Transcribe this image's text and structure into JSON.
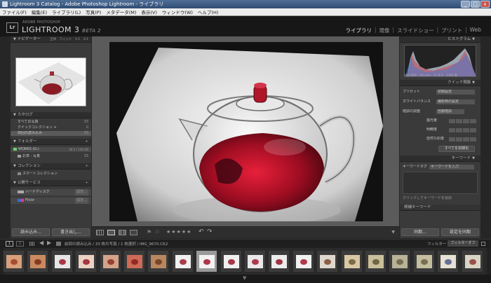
{
  "window": {
    "title": "Lightroom 3 Catalog - Adobe Photoshop Lightroom - ライブラリ",
    "min": "_",
    "max": "□",
    "close": "x"
  },
  "menu": [
    "ファイル(F)",
    "編集(E)",
    "ライブラリ(L)",
    "写真(P)",
    "メタデータ(M)",
    "表示(V)",
    "ウィンドウ(W)",
    "ヘルプ(H)"
  ],
  "brand": {
    "badge": "Lr",
    "line1": "ADOBE PHOTOSHOP",
    "line2": "LIGHTROOM 3",
    "beta": "BETA 2"
  },
  "modules": [
    {
      "label": "ライブラリ",
      "active": true
    },
    {
      "label": "現像",
      "active": false
    },
    {
      "label": "スライドショー",
      "active": false
    },
    {
      "label": "プリント",
      "active": false
    },
    {
      "label": "Web",
      "active": false
    }
  ],
  "left": {
    "navigator": {
      "title": "ナビゲーター",
      "modes": "全体　フィット　1:1　3:1"
    },
    "catalog": {
      "title": "カタログ",
      "items": [
        {
          "label": "すべての写真",
          "count": "33"
        },
        {
          "label": "クイックコレクション +",
          "count": "0"
        },
        {
          "label": "前回の読み込み",
          "count": "33"
        }
      ]
    },
    "folders": {
      "title": "フォルダー",
      "drive": "WORKS (G:)",
      "drive_info": "36.5 / 149 GB",
      "folder": "お茶 - 写真",
      "folder_count": "33"
    },
    "collections": {
      "title": "コレクション",
      "item": "スマートコレクション"
    },
    "publish": {
      "title": "公開サービス",
      "items": [
        {
          "label": "ハードディスク",
          "btn": "設定..."
        },
        {
          "label": "Flickr",
          "btn": "設定..."
        }
      ]
    },
    "import_btn": "読み込み...",
    "export_btn": "書き出し..."
  },
  "right": {
    "histogram": {
      "title": "ヒストグラム",
      "readout": "ISO 400　34 mm　f / 8.0　1/60 秒"
    },
    "quick": {
      "title": "クイック現像",
      "preset_label": "プリセット",
      "preset_val": "初期設定",
      "wb_label": "ホワイトバランス",
      "wb_val": "撮影時の設定",
      "tone_label": "階調の調整",
      "tone_val": "自動階調",
      "rows": [
        "露光量",
        "明瞭度",
        "自然な彩度"
      ],
      "reset": "すべてを初期化"
    },
    "keywords": {
      "title": "キーワード",
      "tag_label": "キーワードタグ",
      "tag_val": "キーワードを入力",
      "hint": "クリックしてキーワードを追加",
      "set_label": "候補キーワード"
    },
    "sync_btn": "同期...",
    "sync_settings_btn": "設定を同期"
  },
  "toolbar": {
    "stars": "★★★★★"
  },
  "filmhdr": {
    "page1": "1",
    "page2": "2",
    "path": "前回の読み込み / 33 枚の写真 / 1 枚選択 / IMG_9670.CR2",
    "filter_label": "フィルター :",
    "filter_val": "フィルターオフ"
  },
  "colors": {
    "accent": "#3e6a9e",
    "panel": "#3a3a3a",
    "bg": "#262626"
  }
}
